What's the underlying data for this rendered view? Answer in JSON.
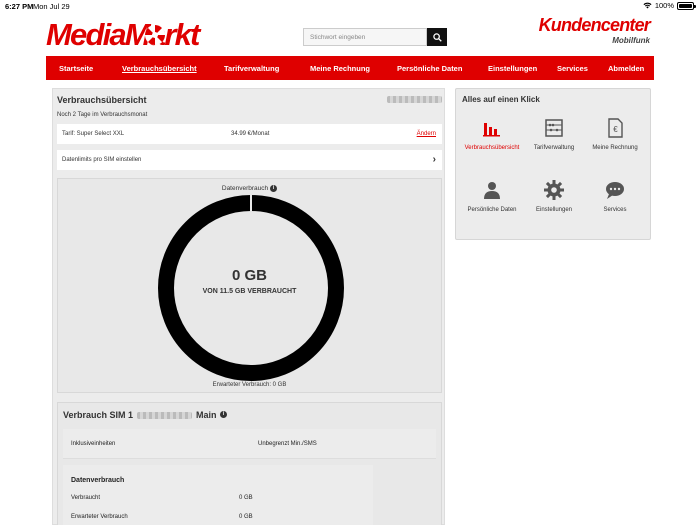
{
  "statusbar": {
    "time": "6:27 PM",
    "date": "Mon Jul 29",
    "battery": "100%"
  },
  "brand": {
    "logo": "MediaMarkt",
    "kundencenter": "Kundencenter",
    "mobilfunk": "Mobilfunk",
    "accent": "#df0000"
  },
  "search": {
    "placeholder": "Stichwort eingeben"
  },
  "nav": {
    "items": [
      {
        "label": "Startseite"
      },
      {
        "label": "Verbrauchsübersicht",
        "active": true
      },
      {
        "label": "Tarifverwaltung"
      },
      {
        "label": "Meine Rechnung"
      },
      {
        "label": "Persönliche Daten"
      },
      {
        "label": "Einstellungen"
      },
      {
        "label": "Services"
      },
      {
        "label": "Abmelden"
      }
    ]
  },
  "overview": {
    "title": "Verbrauchsübersicht",
    "subtitle": "Noch 2 Tage im Verbrauchsmonat",
    "tarif_label": "Tarif: Super Select XXL",
    "tarif_price": "34.99 €/Monat",
    "tarif_change": "Ändern",
    "limits_label": "Datenlimits pro SIM einstellen",
    "usage_label": "Datenverbrauch",
    "usage_value": "0 GB",
    "usage_caption": "VON 11.5 GB VERBRAUCHT",
    "expected": "Erwarteter Verbrauch: 0 GB"
  },
  "sim": {
    "title": "Verbrauch SIM 1",
    "suffix": "Main",
    "inklusiv_label": "Inklusiveinheiten",
    "inklusiv_value": "Unbegrenzt Min./SMS",
    "data_title": "Datenverbrauch",
    "verbraucht_label": "Verbraucht",
    "verbraucht_value": "0 GB",
    "erwartet_label": "Erwarteter Verbrauch",
    "erwartet_value": "0 GB"
  },
  "quick": {
    "title": "Alles auf einen Klick",
    "items": [
      {
        "label": "Verbrauchsübersicht",
        "icon": "bar-chart-icon",
        "active": true
      },
      {
        "label": "Tarifverwaltung",
        "icon": "abacus-icon"
      },
      {
        "label": "Meine Rechnung",
        "icon": "invoice-euro-icon"
      },
      {
        "label": "Persönliche Daten",
        "icon": "person-icon"
      },
      {
        "label": "Einstellungen",
        "icon": "gear-icon"
      },
      {
        "label": "Services",
        "icon": "chat-bubble-icon"
      }
    ]
  }
}
